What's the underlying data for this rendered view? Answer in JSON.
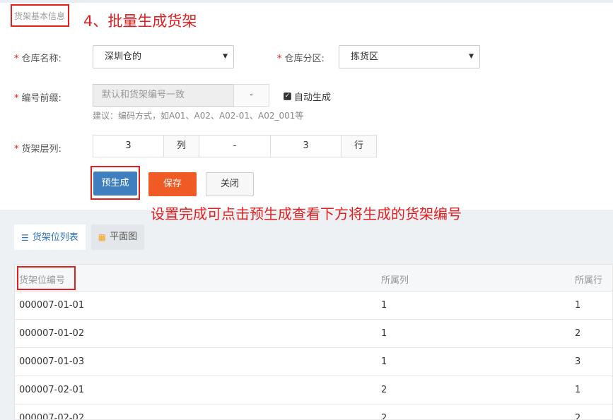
{
  "section_title": "货架基本信息",
  "annotations": {
    "step_title": "4、批量生成货架",
    "prebuild_note": "设置完成可点击预生成查看下方将生成的货架编号"
  },
  "form": {
    "warehouse_name": {
      "label": "仓库名称:",
      "value": "深圳仓的"
    },
    "warehouse_zone": {
      "label": "仓库分区:",
      "value": "拣货区"
    },
    "code_prefix": {
      "label": "编号前缀:",
      "placeholder": "默认和货架编号一致",
      "separator": "-",
      "auto_label": "自动生成",
      "auto_checked": true,
      "hint": "建议：编码方式，如A01、A02、A02-01、A02_001等"
    },
    "rack_layers": {
      "label": "货架层列:",
      "columns_value": "3",
      "columns_unit": "列",
      "separator": "-",
      "rows_value": "3",
      "rows_unit": "行"
    },
    "required_mark": "*"
  },
  "buttons": {
    "prebuild": "预生成",
    "save": "保存",
    "close": "关闭"
  },
  "tabs": [
    {
      "label": "货架位列表",
      "icon": "list-icon",
      "active": true
    },
    {
      "label": "平面图",
      "icon": "grid-icon",
      "active": false
    }
  ],
  "table": {
    "headers": [
      "货架位编号",
      "所属列",
      "所属行"
    ],
    "rows": [
      [
        "000007-01-01",
        "1",
        "1"
      ],
      [
        "000007-01-02",
        "1",
        "2"
      ],
      [
        "000007-01-03",
        "1",
        "3"
      ],
      [
        "000007-02-01",
        "2",
        "1"
      ],
      [
        "000007-02-02",
        "2",
        "2"
      ]
    ]
  },
  "colors": {
    "primary": "#3f7fbf",
    "save_button": "#f05a24",
    "annotation_red": "#e02020",
    "tab_active_text": "#2f74c0"
  }
}
